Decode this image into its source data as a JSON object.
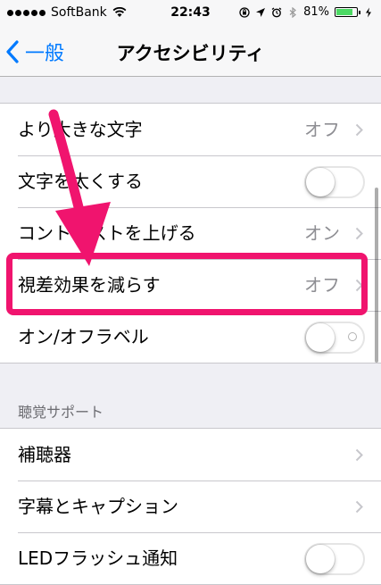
{
  "status_bar": {
    "carrier": "SoftBank",
    "time": "22:43",
    "battery": "81%",
    "battery_level": 0.81,
    "battery_color": "#4cd964",
    "icons": [
      "signal-dots-icon",
      "wifi-icon",
      "rotation-lock-icon",
      "location-icon",
      "alarm-icon",
      "bluetooth-icon",
      "battery-icon",
      "charging-icon"
    ]
  },
  "nav": {
    "back_label": "一般",
    "title": "アクセシビリティ",
    "accent_color": "#007aff"
  },
  "vision_rows": [
    {
      "label": "より大きな文字",
      "value": "オフ",
      "control": "disclosure"
    },
    {
      "label": "文字を太くする",
      "control": "switch",
      "on": false
    },
    {
      "label": "コントラストを上げる",
      "value": "オン",
      "control": "disclosure"
    },
    {
      "label": "視差効果を減らす",
      "value": "オフ",
      "control": "disclosure",
      "highlighted": true
    },
    {
      "label": "オン/オフラベル",
      "control": "switch",
      "on": false,
      "shows_off_label": true
    }
  ],
  "hearing_section": {
    "header": "聴覚サポート",
    "rows": [
      {
        "label": "補聴器",
        "control": "disclosure"
      },
      {
        "label": "字幕とキャプション",
        "control": "disclosure"
      },
      {
        "label": "LEDフラッシュ通知",
        "control": "switch",
        "on": false
      }
    ]
  },
  "annotation": {
    "color": "#f0146e"
  }
}
